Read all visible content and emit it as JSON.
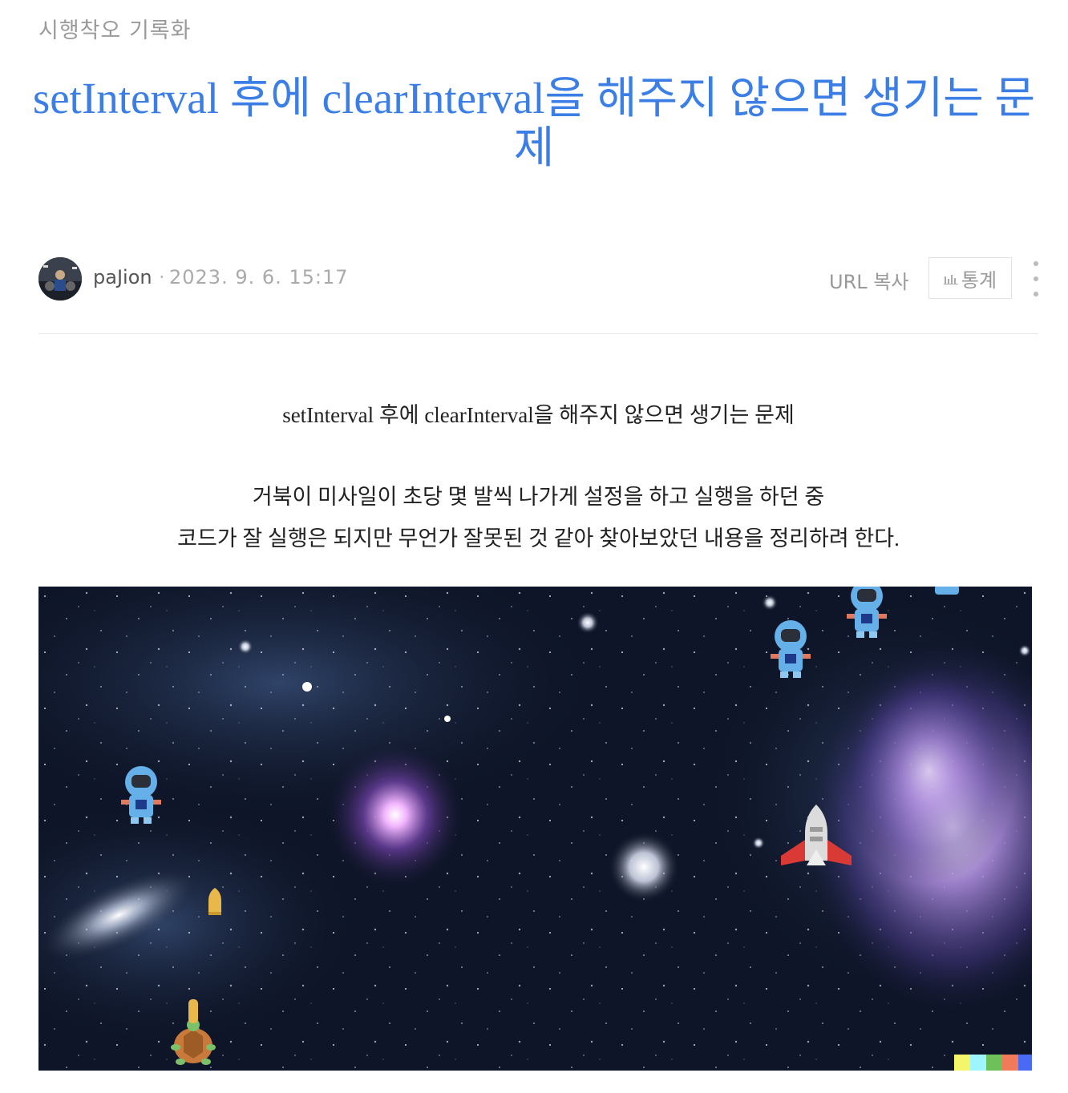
{
  "blog": {
    "category": "시행착오 기록화"
  },
  "post": {
    "title": "setInterval 후에 clearInterval을 해주지 않으면 생기는 문제",
    "author": "paJion",
    "date_separator": "·",
    "date": "2023. 9. 6. 15:17",
    "actions": {
      "url_copy_label": "URL 복사",
      "stats_label": "통계",
      "stats_icon": "bar-chart-icon",
      "more_icon": "vertical-dots-icon"
    },
    "paragraphs": [
      "setInterval 후에 clearInterval을 해주지 않으면 생기는 문제",
      "거북이 미사일이 초당 몇 발씩 나가게 설정을 하고 실행을 하던 중",
      "코드가 잘 실행은 되지만 무언가 잘못된 것 같아 찾아보았던 내용을 정리하려 한다."
    ],
    "image": {
      "description_icons": [
        "astronaut-enemy-icon",
        "rocket-ship-icon",
        "turtle-player-icon",
        "missile-icon"
      ],
      "colors": {
        "space": "#0c1222",
        "accent": "#3a7ee6"
      }
    }
  }
}
